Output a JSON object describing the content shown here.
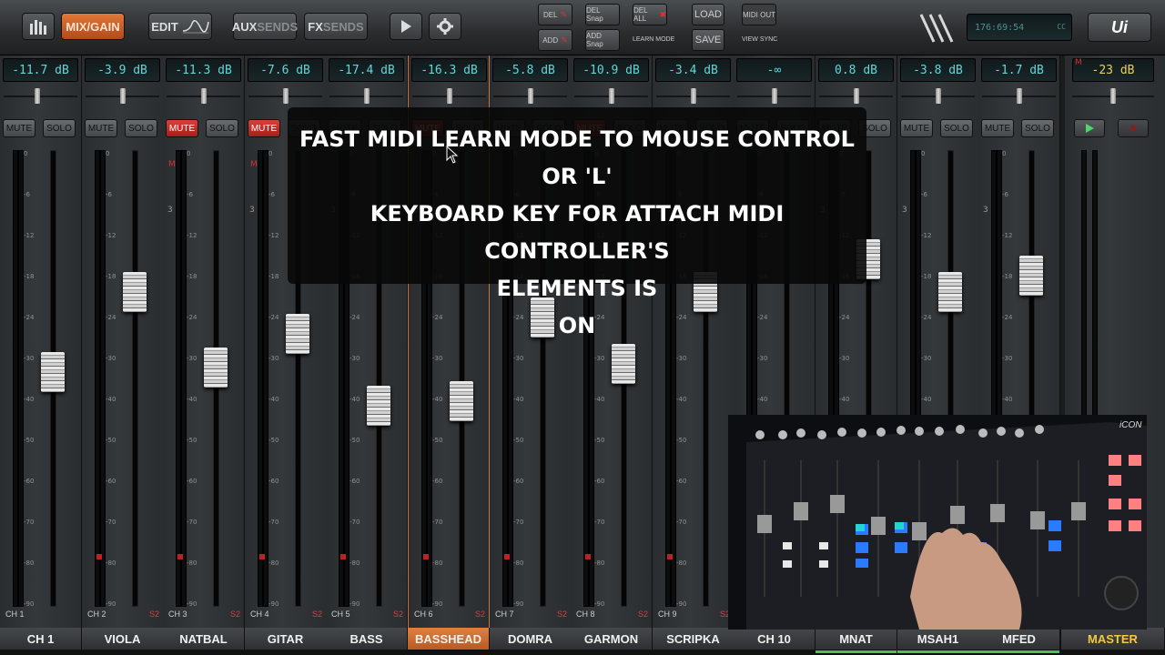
{
  "toolbar": {
    "mixgain_label": "MIX/GAIN",
    "edit_label": "EDIT",
    "aux_label": "AUX",
    "aux_sub": "SENDS",
    "fx_label": "FX",
    "fx_sub": "SENDS",
    "del_label": "DEL",
    "add_label": "ADD",
    "del_snap_label": "DEL Snap",
    "add_snap_label": "ADD Snap",
    "del_all_label": "DEL ALL",
    "learn_mode_label": "LEARN MODE",
    "load_label": "LOAD",
    "save_label": "SAVE",
    "midi_out_label": "MIDI OUT",
    "view_sync_label": "VIEW SYNC",
    "clock_text": "176:69:54",
    "clock_unit": "CC",
    "logo_text": "Ui"
  },
  "overlay": {
    "line1": "FAST MIDI LEARN MODE TO MOUSE CONTROL OR 'L'",
    "line2": "KEYBOARD KEY FOR ATTACH MIDI CONTROLLER'S",
    "line3": "ELEMENTS IS",
    "line4": "ON"
  },
  "buttons": {
    "mute": "MUTE",
    "solo": "SOLO"
  },
  "scale_ticks": [
    "0",
    "-6",
    "-12",
    "-18",
    "-24",
    "-30",
    "-40",
    "-50",
    "-60",
    "-70",
    "-80",
    "-90"
  ],
  "channels": [
    {
      "name": "CH 1",
      "num": "CH 1",
      "db": "-11.7 dB",
      "mute_on": false,
      "fader_level": 0.47,
      "pan": 0.45
    },
    {
      "name": "VIOLA",
      "num": "CH 2",
      "db": "-3.9 dB",
      "mute_on": false,
      "fader_level": 0.66,
      "pan": 0.5
    },
    {
      "name": "NATBAL",
      "num": "CH 3",
      "db": "-11.3 dB",
      "mute_on": true,
      "fader_level": 0.48,
      "pan": 0.5
    },
    {
      "name": "GITAR",
      "num": "CH 4",
      "db": "-7.6 dB",
      "mute_on": true,
      "fader_level": 0.56,
      "pan": 0.5
    },
    {
      "name": "BASS",
      "num": "CH 5",
      "db": "-17.4 dB",
      "mute_on": false,
      "fader_level": 0.39,
      "pan": 0.5
    },
    {
      "name": "BASSHEAD",
      "num": "CH 6",
      "db": "-16.3 dB",
      "mute_on": true,
      "fader_level": 0.4,
      "pan": 0.5
    },
    {
      "name": "DOMRA",
      "num": "CH 7",
      "db": "-5.8 dB",
      "mute_on": false,
      "fader_level": 0.6,
      "pan": 0.5
    },
    {
      "name": "GARMON",
      "num": "CH 8",
      "db": "-10.9 dB",
      "mute_on": true,
      "fader_level": 0.49,
      "pan": 0.5
    },
    {
      "name": "SCRIPKA",
      "num": "CH 9",
      "db": "-3.4 dB",
      "mute_on": false,
      "fader_level": 0.66,
      "pan": 0.5
    },
    {
      "name": "CH 10",
      "num": "CH 10",
      "db": "-∞",
      "mute_on": false,
      "fader_level": 0.0,
      "pan": 0.5
    },
    {
      "name": "MNAT",
      "num": "",
      "db": "0.8 dB",
      "mute_on": false,
      "fader_level": 0.74,
      "pan": 0.5
    },
    {
      "name": "MSAH1",
      "num": "",
      "db": "-3.8 dB",
      "mute_on": false,
      "fader_level": 0.66,
      "pan": 0.5
    },
    {
      "name": "MFED",
      "num": "",
      "db": "-1.7 dB",
      "mute_on": false,
      "fader_level": 0.7,
      "pan": 0.5
    }
  ],
  "master": {
    "name": "MASTER",
    "db": "-23 dB",
    "m_label": "M"
  },
  "colors": {
    "accent": "#c8713a",
    "mute_on": "#c5302b",
    "db_text": "#5fd8d8",
    "master_text": "#f6c93a",
    "bus_bar": "#4bbf5a"
  },
  "labels": {
    "s2": "S2",
    "m": "M",
    "three": "3",
    "iconlogo": "iCON"
  }
}
